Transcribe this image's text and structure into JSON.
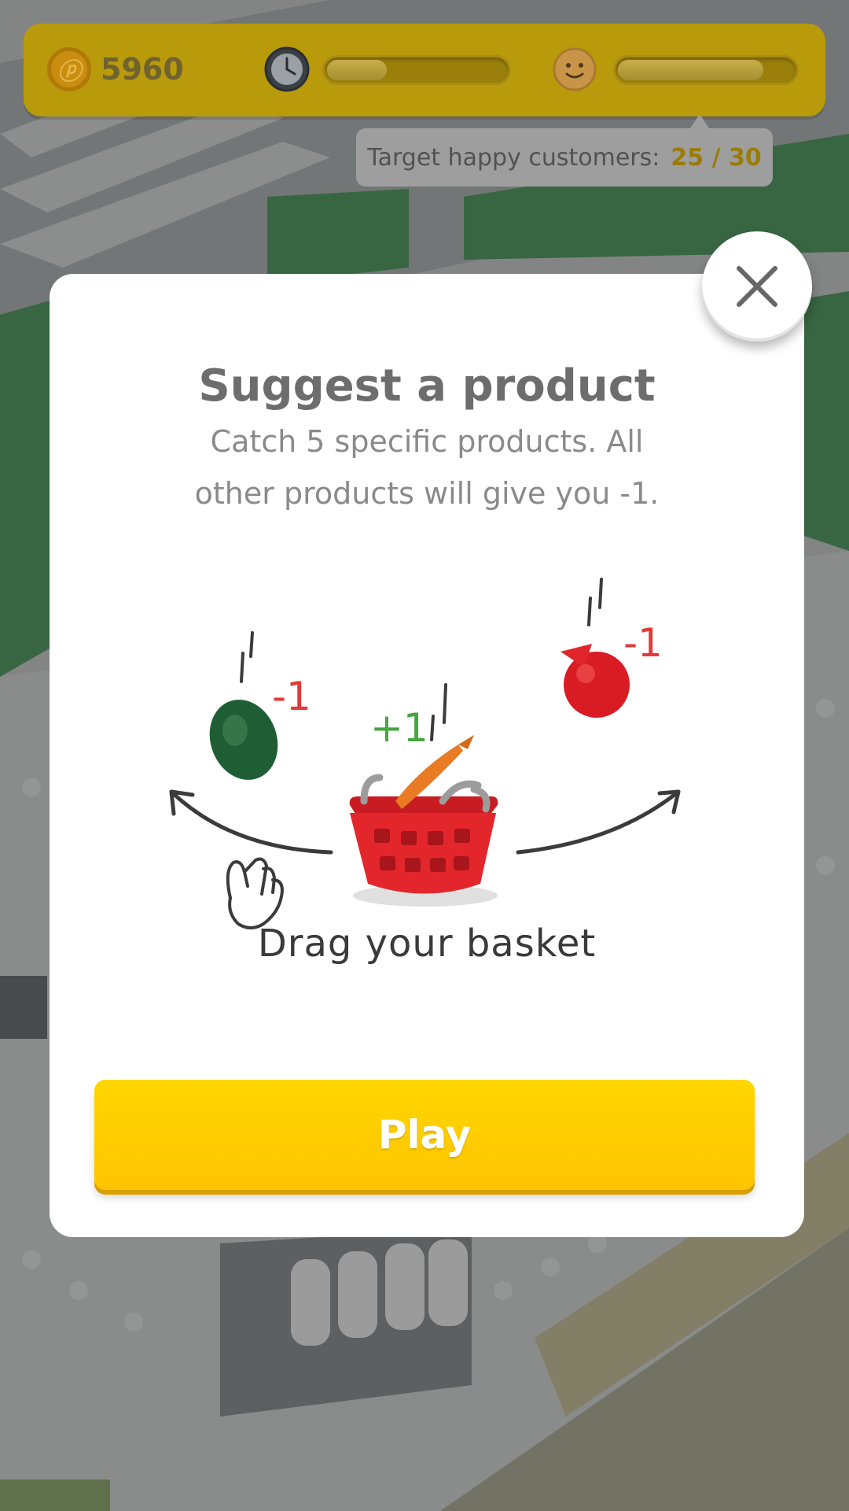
{
  "hud": {
    "coin_value": "5960",
    "coin_icon": "coin-icon",
    "clock_icon": "clock-icon",
    "smiley_icon": "smiley-icon",
    "time_progress": 0.35,
    "happy_progress": 0.83,
    "accent_color": "#b89a0a"
  },
  "tooltip": {
    "label": "Target happy customers:",
    "value": "25 / 30"
  },
  "modal": {
    "title": "Suggest a product",
    "description": "Catch 5 specific products. All other products will give you -1.",
    "illustration": {
      "left_product_score": "-1",
      "right_product_score": "-1",
      "caught_product_score": "+1",
      "drag_hint": "Drag your basket"
    },
    "play_label": "Play",
    "close_icon": "close-icon"
  },
  "colors": {
    "play_button": "#ffc400",
    "negative_score": "#e23a3a",
    "positive_score": "#47a63d"
  }
}
